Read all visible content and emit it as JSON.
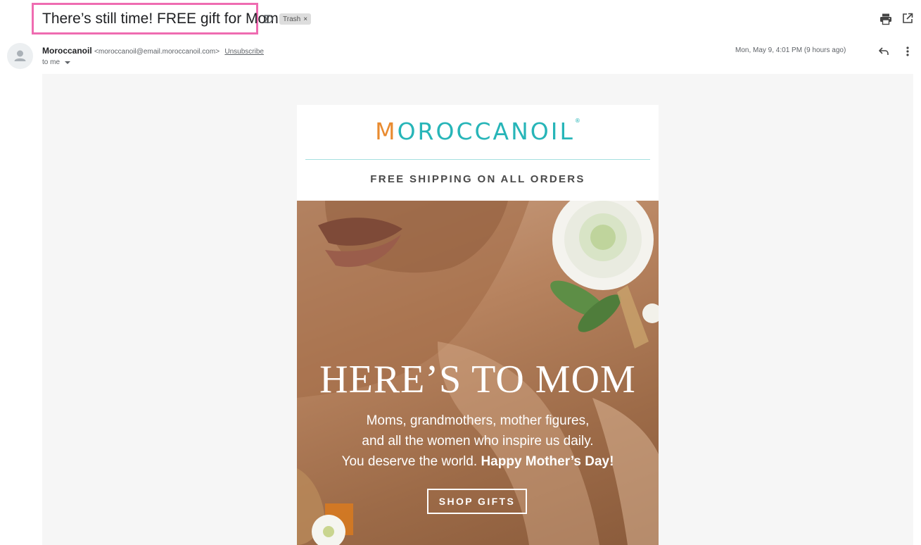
{
  "header": {
    "subject": "There’s still time! FREE gift for Mom",
    "label": "Trash",
    "label_remove": "×",
    "icons": {
      "important": "label-important-icon",
      "print": "print-icon",
      "new_window": "open-in-new-icon"
    }
  },
  "message": {
    "sender_name": "Moroccanoil",
    "sender_email": "<moroccanoil@email.moroccanoil.com>",
    "unsubscribe": "Unsubscribe",
    "to": "to me",
    "date": "Mon, May 9, 4:01 PM (9 hours ago)",
    "icons": {
      "reply": "reply-icon",
      "more": "more-vert-icon"
    }
  },
  "email": {
    "brand": {
      "letters": "MOROCCANOIL",
      "first": "M",
      "rest": "OROCCANOIL",
      "reg": "®"
    },
    "shipping": "FREE SHIPPING ON ALL ORDERS",
    "hero_title": "HERE’S TO MOM",
    "copy_line1": "Moms, grandmothers, mother figures,",
    "copy_line2": "and all the women who inspire us daily.",
    "copy_line3_plain": "You deserve the world. ",
    "copy_line3_bold": "Happy Mother’s Day!",
    "cta": "SHOP GIFTS"
  },
  "colors": {
    "highlight_border": "#ef6cb1",
    "brand_teal": "#27b5b8",
    "brand_orange": "#e98b30"
  }
}
